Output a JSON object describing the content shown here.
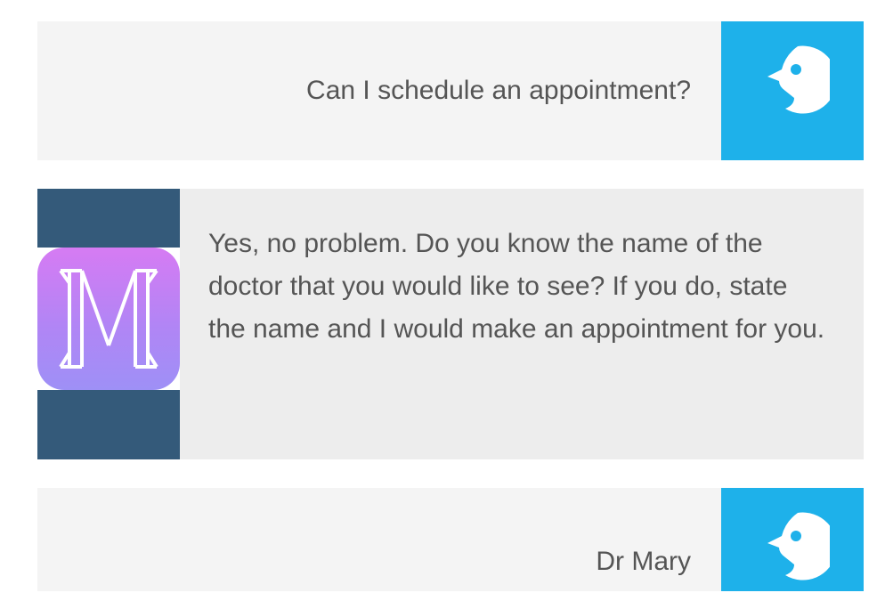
{
  "messages": [
    {
      "sender": "user",
      "text": "Can I schedule an appointment?",
      "avatar_icon": "user-face-icon",
      "avatar_color": "#1eb1ea"
    },
    {
      "sender": "bot",
      "text": "Yes, no problem. Do you know the name of the doctor that you would like to see? If you do, state the name and I would make an appointment for you.",
      "avatar_icon": "m-logo-icon",
      "avatar_color": "#345a7a"
    },
    {
      "sender": "user",
      "text": "Dr Mary",
      "avatar_icon": "user-face-icon",
      "avatar_color": "#1eb1ea"
    }
  ]
}
